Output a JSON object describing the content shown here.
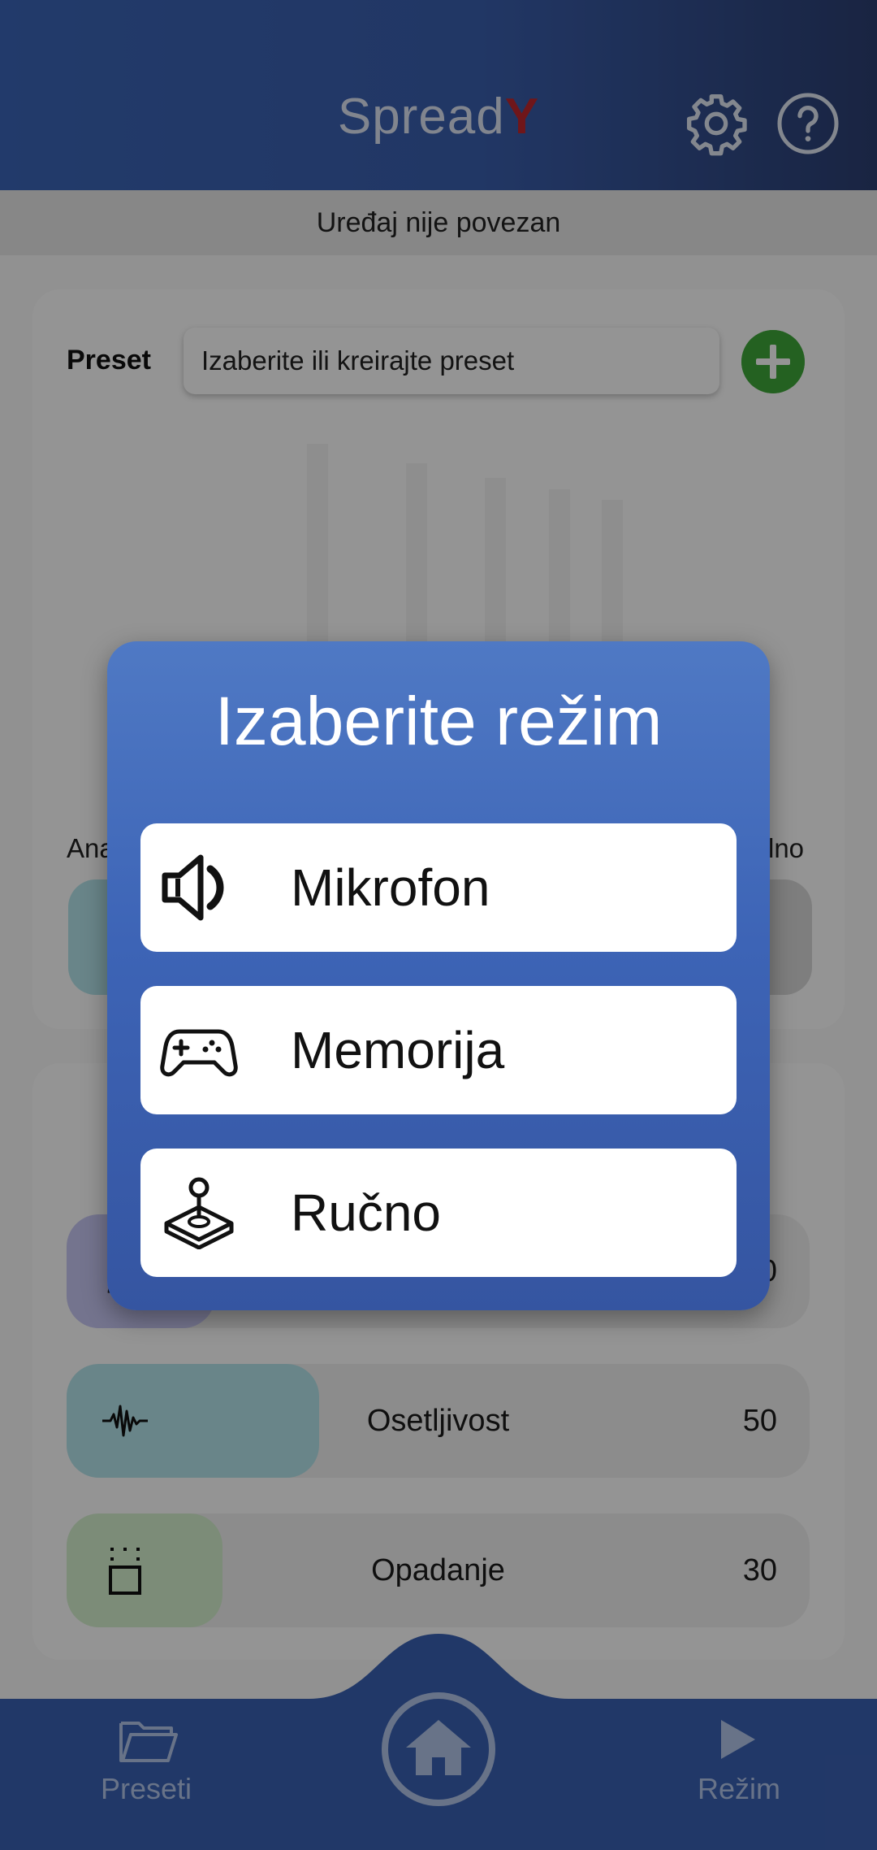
{
  "header": {
    "title_text": "Spread",
    "title_logo_letter": "Y",
    "icons": {
      "settings": "gear-icon",
      "help": "help-icon"
    }
  },
  "status": {
    "text": "Uređaj nije povezan"
  },
  "preset": {
    "label": "Preset",
    "placeholder": "Izaberite ili kreirajte preset"
  },
  "mode_row": {
    "left_label_visible": "Ana",
    "right_label_visible": "lno"
  },
  "sliders": [
    {
      "label": "",
      "value": "0",
      "icon": "person-icon",
      "fill_percent": 20,
      "color": "#c8c8f4"
    },
    {
      "label": "Osetljivost",
      "value": "50",
      "icon": "waveform-icon",
      "fill_percent": 34,
      "color": "#b6e6ec"
    },
    {
      "label": "Opadanje",
      "value": "30",
      "icon": "decay-icon",
      "fill_percent": 21,
      "color": "#d6f2cf"
    }
  ],
  "bottom_nav": {
    "presets_label": "Preseti",
    "mode_label": "Režim"
  },
  "dialog": {
    "title": "Izaberite režim",
    "options": [
      {
        "label": "Mikrofon",
        "icon": "speaker-icon"
      },
      {
        "label": "Memorija",
        "icon": "gamepad-icon"
      },
      {
        "label": "Ručno",
        "icon": "joystick-icon"
      }
    ]
  },
  "colors": {
    "primary": "#3d64b6",
    "add_button": "#3fa83a",
    "logo_accent": "#c0272d"
  }
}
